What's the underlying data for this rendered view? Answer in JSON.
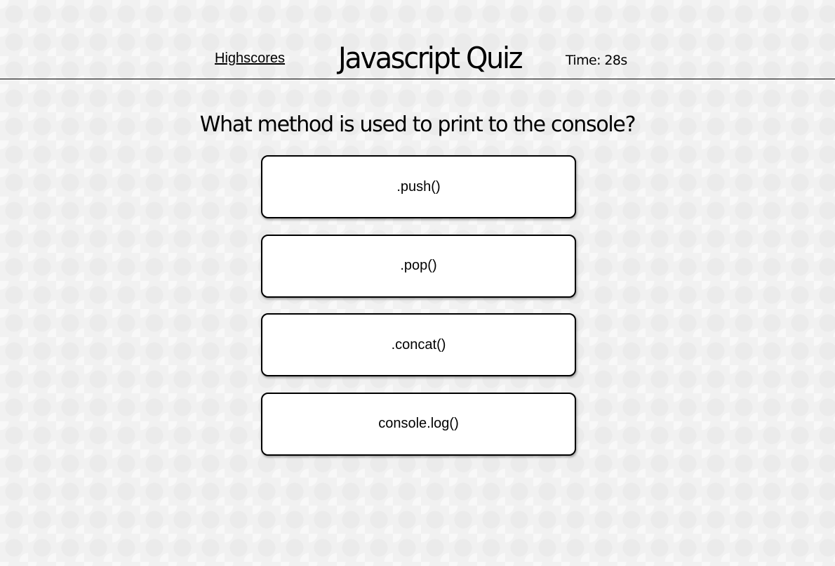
{
  "header": {
    "highscores_label": "Highscores",
    "title": "Javascript Quiz",
    "timer_label": "Time: 28s"
  },
  "quiz": {
    "question": "What method is used to print to the console?",
    "answers": [
      {
        "label": ".push()"
      },
      {
        "label": ".pop()"
      },
      {
        "label": ".concat()"
      },
      {
        "label": "console.log()"
      }
    ]
  }
}
